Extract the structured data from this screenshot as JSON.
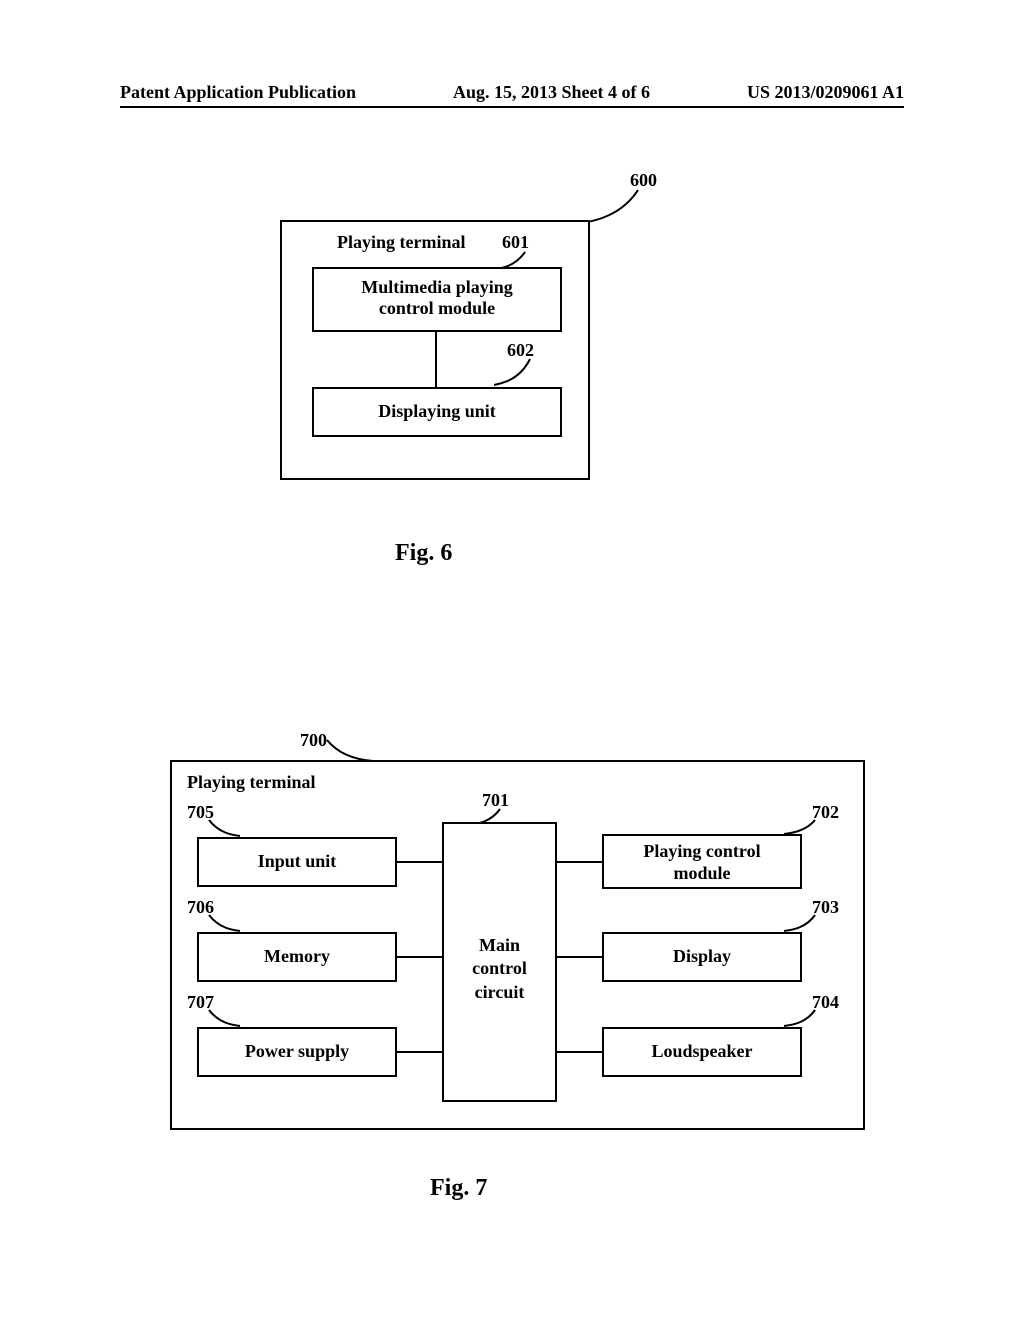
{
  "header": {
    "left": "Patent Application Publication",
    "center": "Aug. 15, 2013  Sheet 4 of 6",
    "right": "US 2013/0209061 A1"
  },
  "fig6": {
    "caption": "Fig. 6",
    "outer_ref": "600",
    "outer_title": "Playing terminal",
    "block1_ref": "601",
    "block1_text_line1": "Multimedia playing",
    "block1_text_line2": "control module",
    "block2_ref": "602",
    "block2_text": "Displaying unit"
  },
  "fig7": {
    "caption": "Fig. 7",
    "outer_ref": "700",
    "outer_title": "Playing terminal",
    "center_block_line1": "Main",
    "center_block_line2": "control",
    "center_block_line3": "circuit",
    "center_ref": "701",
    "right1_ref": "702",
    "right1_text_line1": "Playing control",
    "right1_text_line2": "module",
    "right2_ref": "703",
    "right2_text": "Display",
    "right3_ref": "704",
    "right3_text": "Loudspeaker",
    "left1_ref": "705",
    "left1_text": "Input unit",
    "left2_ref": "706",
    "left2_text": "Memory",
    "left3_ref": "707",
    "left3_text": "Power supply"
  }
}
